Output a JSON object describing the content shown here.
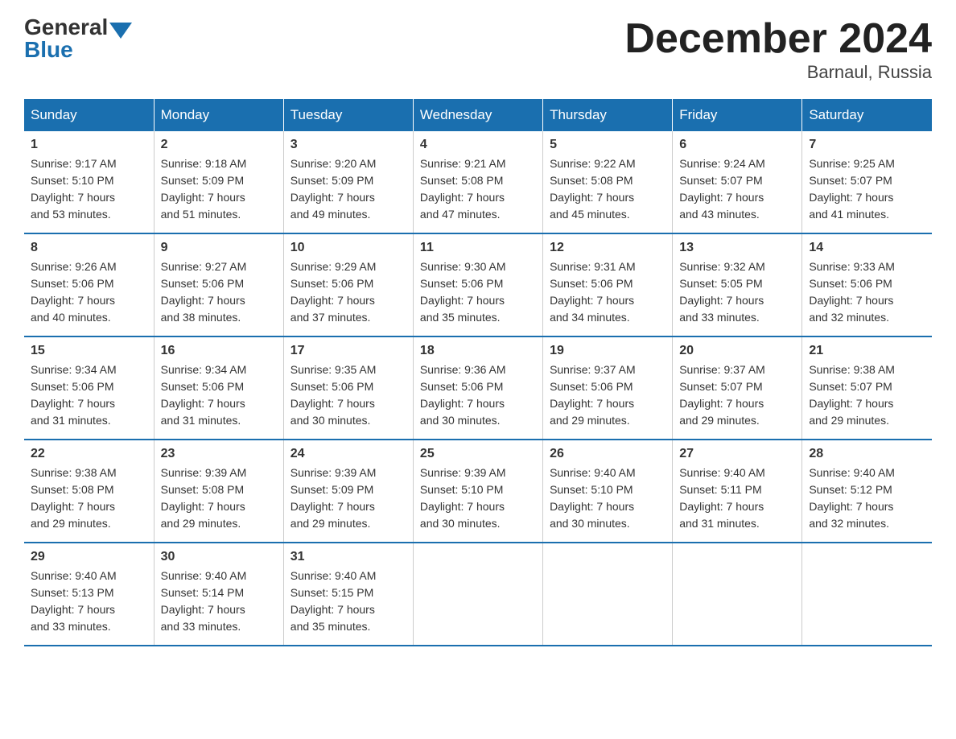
{
  "header": {
    "logo_general": "General",
    "logo_blue": "Blue",
    "month_title": "December 2024",
    "location": "Barnaul, Russia"
  },
  "days_of_week": [
    "Sunday",
    "Monday",
    "Tuesday",
    "Wednesday",
    "Thursday",
    "Friday",
    "Saturday"
  ],
  "weeks": [
    [
      {
        "day": "1",
        "info": "Sunrise: 9:17 AM\nSunset: 5:10 PM\nDaylight: 7 hours\nand 53 minutes."
      },
      {
        "day": "2",
        "info": "Sunrise: 9:18 AM\nSunset: 5:09 PM\nDaylight: 7 hours\nand 51 minutes."
      },
      {
        "day": "3",
        "info": "Sunrise: 9:20 AM\nSunset: 5:09 PM\nDaylight: 7 hours\nand 49 minutes."
      },
      {
        "day": "4",
        "info": "Sunrise: 9:21 AM\nSunset: 5:08 PM\nDaylight: 7 hours\nand 47 minutes."
      },
      {
        "day": "5",
        "info": "Sunrise: 9:22 AM\nSunset: 5:08 PM\nDaylight: 7 hours\nand 45 minutes."
      },
      {
        "day": "6",
        "info": "Sunrise: 9:24 AM\nSunset: 5:07 PM\nDaylight: 7 hours\nand 43 minutes."
      },
      {
        "day": "7",
        "info": "Sunrise: 9:25 AM\nSunset: 5:07 PM\nDaylight: 7 hours\nand 41 minutes."
      }
    ],
    [
      {
        "day": "8",
        "info": "Sunrise: 9:26 AM\nSunset: 5:06 PM\nDaylight: 7 hours\nand 40 minutes."
      },
      {
        "day": "9",
        "info": "Sunrise: 9:27 AM\nSunset: 5:06 PM\nDaylight: 7 hours\nand 38 minutes."
      },
      {
        "day": "10",
        "info": "Sunrise: 9:29 AM\nSunset: 5:06 PM\nDaylight: 7 hours\nand 37 minutes."
      },
      {
        "day": "11",
        "info": "Sunrise: 9:30 AM\nSunset: 5:06 PM\nDaylight: 7 hours\nand 35 minutes."
      },
      {
        "day": "12",
        "info": "Sunrise: 9:31 AM\nSunset: 5:06 PM\nDaylight: 7 hours\nand 34 minutes."
      },
      {
        "day": "13",
        "info": "Sunrise: 9:32 AM\nSunset: 5:05 PM\nDaylight: 7 hours\nand 33 minutes."
      },
      {
        "day": "14",
        "info": "Sunrise: 9:33 AM\nSunset: 5:06 PM\nDaylight: 7 hours\nand 32 minutes."
      }
    ],
    [
      {
        "day": "15",
        "info": "Sunrise: 9:34 AM\nSunset: 5:06 PM\nDaylight: 7 hours\nand 31 minutes."
      },
      {
        "day": "16",
        "info": "Sunrise: 9:34 AM\nSunset: 5:06 PM\nDaylight: 7 hours\nand 31 minutes."
      },
      {
        "day": "17",
        "info": "Sunrise: 9:35 AM\nSunset: 5:06 PM\nDaylight: 7 hours\nand 30 minutes."
      },
      {
        "day": "18",
        "info": "Sunrise: 9:36 AM\nSunset: 5:06 PM\nDaylight: 7 hours\nand 30 minutes."
      },
      {
        "day": "19",
        "info": "Sunrise: 9:37 AM\nSunset: 5:06 PM\nDaylight: 7 hours\nand 29 minutes."
      },
      {
        "day": "20",
        "info": "Sunrise: 9:37 AM\nSunset: 5:07 PM\nDaylight: 7 hours\nand 29 minutes."
      },
      {
        "day": "21",
        "info": "Sunrise: 9:38 AM\nSunset: 5:07 PM\nDaylight: 7 hours\nand 29 minutes."
      }
    ],
    [
      {
        "day": "22",
        "info": "Sunrise: 9:38 AM\nSunset: 5:08 PM\nDaylight: 7 hours\nand 29 minutes."
      },
      {
        "day": "23",
        "info": "Sunrise: 9:39 AM\nSunset: 5:08 PM\nDaylight: 7 hours\nand 29 minutes."
      },
      {
        "day": "24",
        "info": "Sunrise: 9:39 AM\nSunset: 5:09 PM\nDaylight: 7 hours\nand 29 minutes."
      },
      {
        "day": "25",
        "info": "Sunrise: 9:39 AM\nSunset: 5:10 PM\nDaylight: 7 hours\nand 30 minutes."
      },
      {
        "day": "26",
        "info": "Sunrise: 9:40 AM\nSunset: 5:10 PM\nDaylight: 7 hours\nand 30 minutes."
      },
      {
        "day": "27",
        "info": "Sunrise: 9:40 AM\nSunset: 5:11 PM\nDaylight: 7 hours\nand 31 minutes."
      },
      {
        "day": "28",
        "info": "Sunrise: 9:40 AM\nSunset: 5:12 PM\nDaylight: 7 hours\nand 32 minutes."
      }
    ],
    [
      {
        "day": "29",
        "info": "Sunrise: 9:40 AM\nSunset: 5:13 PM\nDaylight: 7 hours\nand 33 minutes."
      },
      {
        "day": "30",
        "info": "Sunrise: 9:40 AM\nSunset: 5:14 PM\nDaylight: 7 hours\nand 33 minutes."
      },
      {
        "day": "31",
        "info": "Sunrise: 9:40 AM\nSunset: 5:15 PM\nDaylight: 7 hours\nand 35 minutes."
      },
      {
        "day": "",
        "info": ""
      },
      {
        "day": "",
        "info": ""
      },
      {
        "day": "",
        "info": ""
      },
      {
        "day": "",
        "info": ""
      }
    ]
  ]
}
